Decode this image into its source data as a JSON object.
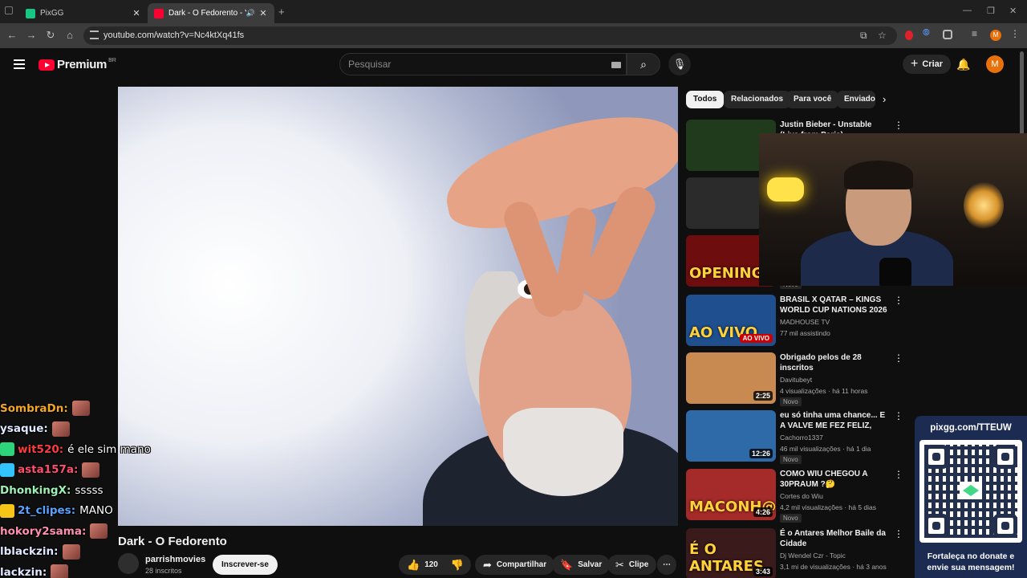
{
  "browser": {
    "tabs": [
      {
        "title": "PixGG"
      },
      {
        "title": "Dark - O Fedorento - YouTube"
      }
    ],
    "url": "youtube.com/watch?v=Nc4ktXq41fs",
    "profile_initial": "M"
  },
  "masthead": {
    "brand": "Premium",
    "region": "BR",
    "search_placeholder": "Pesquisar",
    "create_label": "Criar",
    "avatar_initial": "M"
  },
  "video": {
    "title": "Dark - O Fedorento",
    "channel": "parrishmovies",
    "subscribers": "28 inscritos",
    "subscribe_label": "Inscrever-se",
    "likes": "120",
    "share_label": "Compartilhar",
    "save_label": "Salvar",
    "clip_label": "Clipe"
  },
  "chips": [
    "Todos",
    "Relacionados",
    "Para você",
    "Enviados"
  ],
  "related": [
    {
      "title": "Justin Bieber - Unstable (Live from Paris)",
      "channel": "",
      "meta": "",
      "badge": "",
      "duration": "",
      "thumb": "#1f3b1c"
    },
    {
      "title": "",
      "channel": "",
      "meta": "",
      "badge": "",
      "duration": "",
      "thumb": "#2b2b2b"
    },
    {
      "title": "",
      "channel": "",
      "meta": "",
      "badge": "Novo",
      "duration": "",
      "thumb": "#6d0d0d",
      "thumb_text": "OPENING"
    },
    {
      "title": "BRASIL X QATAR – KINGS WORLD CUP NATIONS 2026 – ...",
      "channel": "MADHOUSE TV",
      "meta": "77 mil assistindo",
      "badge": "",
      "live": "AO VIVO",
      "thumb": "#1f4f8f",
      "thumb_text": "AO VIVO"
    },
    {
      "title": "Obrigado pelos de 28 inscritos",
      "channel": "Davitubeyt",
      "meta": "4 visualizações · há 11 horas",
      "badge": "Novo",
      "duration": "2:25",
      "thumb": "#c98a52"
    },
    {
      "title": "eu só tinha uma chance... E A VALVE ME FEZ FELIZ, MUITO ...",
      "channel": "Cachorro1337",
      "meta": "46 mil visualizações · há 1 dia",
      "badge": "Novo",
      "duration": "12:26",
      "thumb": "#2e6aa8"
    },
    {
      "title": "COMO WIU CHEGOU A 30PRAUM ?🤔",
      "channel": "Cortes do Wiu",
      "meta": "4,2 mil visualizações · há 5 dias",
      "badge": "Novo",
      "duration": "4:26",
      "thumb": "#a52a2a",
      "thumb_text": "MACONH@"
    },
    {
      "title": "É o Antares Melhor Baile da Cidade",
      "channel": "Dj Wendel Czr - Topic",
      "meta": "3,1 mi de visualizações · há 3 anos",
      "badge": "",
      "duration": "3:43",
      "thumb": "#3a1a1a",
      "thumb_text": "É O ANTARES"
    }
  ],
  "chat": [
    {
      "user": "SombraDn:",
      "color": "#f5a623",
      "msg": "",
      "emote": true
    },
    {
      "user": "ysaque:",
      "color": "#dfe8ff",
      "msg": "",
      "emote": true
    },
    {
      "user": "wit520:",
      "color": "#ff3b3b",
      "msg": "é ele sim mano",
      "emote": false,
      "badge": "#2ed47a"
    },
    {
      "user": "asta157a:",
      "color": "#ff4d6d",
      "msg": "",
      "emote": true,
      "badge": "#33c4ff"
    },
    {
      "user": "DhonkingX:",
      "color": "#9cf1b3",
      "msg": "sssss",
      "emote": false
    },
    {
      "user": "2t_clipes:",
      "color": "#5aa2ff",
      "msg": "MANO",
      "emote": false,
      "badge": "#f5c518"
    },
    {
      "user": "hokory2sama:",
      "color": "#ff8fb1",
      "msg": "",
      "emote": true
    },
    {
      "user": "lblackzin:",
      "color": "#dfe8ff",
      "msg": "",
      "emote": true
    },
    {
      "user": "lackzin:",
      "color": "#dfe8ff",
      "msg": "",
      "emote": true
    }
  ],
  "donation": {
    "url": "pixgg.com/TTEUW",
    "message_line1": "Fortaleça no donate e",
    "message_line2": "envie sua mensagem!"
  },
  "colors": {
    "youtube_red": "#ff0033",
    "page_bg": "#0f0f0f",
    "qr_panel": "#1b2b52"
  }
}
